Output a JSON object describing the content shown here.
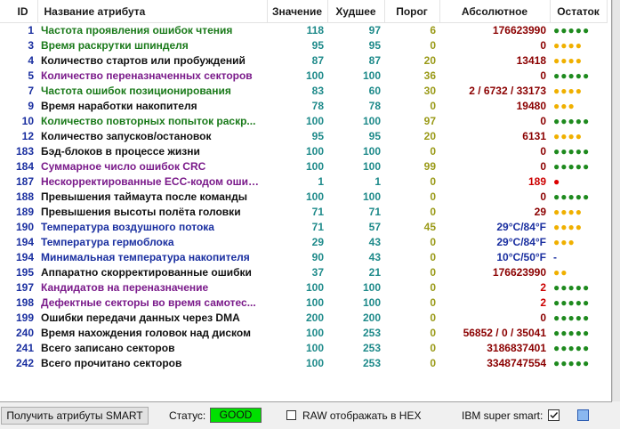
{
  "colors": {
    "blue": "#1a2fa0",
    "green": "#1a7a1a",
    "purple": "#7a1a8a",
    "black": "#111111",
    "red": "#cc0000",
    "current_value": "#1e8a8a",
    "threshold": "#9a9a18",
    "raw_value": "#8b0000",
    "dot_green": "#1e8a1e",
    "dot_yellow": "#f0b000",
    "dot_red": "#dd0000",
    "status_good": "#00e000"
  },
  "table": {
    "headers": {
      "id": "ID",
      "name": "Название атрибута",
      "current": "Значение",
      "worst": "Худшее",
      "threshold": "Порог",
      "raw": "Абсолютное",
      "remaining": "Остаток"
    },
    "rows": [
      {
        "id": "1",
        "name": "Частота проявления ошибок чтения",
        "name_color": "green",
        "current": "118",
        "worst": "97",
        "threshold": "6",
        "raw": "176623990",
        "raw_color": "raw_value",
        "remaining": "●●●●●",
        "remaining_color": "dot_green"
      },
      {
        "id": "3",
        "name": "Время раскрутки шпинделя",
        "name_color": "green",
        "current": "95",
        "worst": "95",
        "threshold": "0",
        "raw": "0",
        "raw_color": "raw_value",
        "remaining": "●●●●",
        "remaining_color": "dot_yellow"
      },
      {
        "id": "4",
        "name": "Количество стартов или пробуждений",
        "name_color": "black",
        "current": "87",
        "worst": "87",
        "threshold": "20",
        "raw": "13418",
        "raw_color": "raw_value",
        "remaining": "●●●●",
        "remaining_color": "dot_yellow"
      },
      {
        "id": "5",
        "name": "Количество переназначенных секторов",
        "name_color": "purple",
        "current": "100",
        "worst": "100",
        "threshold": "36",
        "raw": "0",
        "raw_color": "raw_value",
        "remaining": "●●●●●",
        "remaining_color": "dot_green"
      },
      {
        "id": "7",
        "name": "Частота ошибок позиционирования",
        "name_color": "green",
        "current": "83",
        "worst": "60",
        "threshold": "30",
        "raw": "2 / 6732 / 33173",
        "raw_color": "raw_value",
        "remaining": "●●●●",
        "remaining_color": "dot_yellow"
      },
      {
        "id": "9",
        "name": "Время наработки накопителя",
        "name_color": "black",
        "current": "78",
        "worst": "78",
        "threshold": "0",
        "raw": "19480",
        "raw_color": "raw_value",
        "remaining": "●●●",
        "remaining_color": "dot_yellow"
      },
      {
        "id": "10",
        "name": "Количество повторных попыток раскр...",
        "name_color": "green",
        "current": "100",
        "worst": "100",
        "threshold": "97",
        "raw": "0",
        "raw_color": "raw_value",
        "remaining": "●●●●●",
        "remaining_color": "dot_green"
      },
      {
        "id": "12",
        "name": "Количество запусков/остановок",
        "name_color": "black",
        "current": "95",
        "worst": "95",
        "threshold": "20",
        "raw": "6131",
        "raw_color": "raw_value",
        "remaining": "●●●●",
        "remaining_color": "dot_yellow"
      },
      {
        "id": "183",
        "name": "Бэд-блоков в процессе жизни",
        "name_color": "black",
        "current": "100",
        "worst": "100",
        "threshold": "0",
        "raw": "0",
        "raw_color": "raw_value",
        "remaining": "●●●●●",
        "remaining_color": "dot_green"
      },
      {
        "id": "184",
        "name": "Суммарное число ошибок CRC",
        "name_color": "purple",
        "current": "100",
        "worst": "100",
        "threshold": "99",
        "raw": "0",
        "raw_color": "raw_value",
        "remaining": "●●●●●",
        "remaining_color": "dot_green"
      },
      {
        "id": "187",
        "name": "Нескорректированные ECC-кодом ошиб...",
        "name_color": "purple",
        "current": "1",
        "worst": "1",
        "threshold": "0",
        "raw": "189",
        "raw_color": "red",
        "remaining": "●",
        "remaining_color": "dot_red"
      },
      {
        "id": "188",
        "name": "Превышения таймаута после команды",
        "name_color": "black",
        "current": "100",
        "worst": "100",
        "threshold": "0",
        "raw": "0",
        "raw_color": "raw_value",
        "remaining": "●●●●●",
        "remaining_color": "dot_green"
      },
      {
        "id": "189",
        "name": "Превышения высоты полёта головки",
        "name_color": "black",
        "current": "71",
        "worst": "71",
        "threshold": "0",
        "raw": "29",
        "raw_color": "raw_value",
        "remaining": "●●●●",
        "remaining_color": "dot_yellow"
      },
      {
        "id": "190",
        "name": "Температура воздушного потока",
        "name_color": "blue",
        "current": "71",
        "worst": "57",
        "threshold": "45",
        "raw": "29°C/84°F",
        "raw_color": "blue",
        "remaining": "●●●●",
        "remaining_color": "dot_yellow"
      },
      {
        "id": "194",
        "name": "Температура гермоблока",
        "name_color": "blue",
        "current": "29",
        "worst": "43",
        "threshold": "0",
        "raw": "29°C/84°F",
        "raw_color": "blue",
        "remaining": "●●●",
        "remaining_color": "dot_yellow"
      },
      {
        "id": "194",
        "name": "Минимальная температура накопителя",
        "name_color": "blue",
        "current": "90",
        "worst": "43",
        "threshold": "0",
        "raw": "10°C/50°F",
        "raw_color": "blue",
        "remaining": "-",
        "remaining_color": "blue"
      },
      {
        "id": "195",
        "name": "Аппаратно скорректированные ошибки",
        "name_color": "black",
        "current": "37",
        "worst": "21",
        "threshold": "0",
        "raw": "176623990",
        "raw_color": "raw_value",
        "remaining": "●●",
        "remaining_color": "dot_yellow"
      },
      {
        "id": "197",
        "name": "Кандидатов на переназначение",
        "name_color": "purple",
        "current": "100",
        "worst": "100",
        "threshold": "0",
        "raw": "2",
        "raw_color": "red",
        "remaining": "●●●●●",
        "remaining_color": "dot_green"
      },
      {
        "id": "198",
        "name": "Дефектные секторы во время самотес...",
        "name_color": "purple",
        "current": "100",
        "worst": "100",
        "threshold": "0",
        "raw": "2",
        "raw_color": "red",
        "remaining": "●●●●●",
        "remaining_color": "dot_green"
      },
      {
        "id": "199",
        "name": "Ошибки передачи данных через DMA",
        "name_color": "black",
        "current": "200",
        "worst": "200",
        "threshold": "0",
        "raw": "0",
        "raw_color": "raw_value",
        "remaining": "●●●●●",
        "remaining_color": "dot_green"
      },
      {
        "id": "240",
        "name": "Время нахождения головок над диском",
        "name_color": "black",
        "current": "100",
        "worst": "253",
        "threshold": "0",
        "raw": "56852 / 0 / 35041",
        "raw_color": "raw_value",
        "remaining": "●●●●●",
        "remaining_color": "dot_green"
      },
      {
        "id": "241",
        "name": "Всего записано секторов",
        "name_color": "black",
        "current": "100",
        "worst": "253",
        "threshold": "0",
        "raw": "3186837401",
        "raw_color": "raw_value",
        "remaining": "●●●●●",
        "remaining_color": "dot_green"
      },
      {
        "id": "242",
        "name": "Всего прочитано секторов",
        "name_color": "black",
        "current": "100",
        "worst": "253",
        "threshold": "0",
        "raw": "3348747554",
        "raw_color": "raw_value",
        "remaining": "●●●●●",
        "remaining_color": "dot_green"
      }
    ]
  },
  "statusbar": {
    "get_button_label": "Получить атрибуты SMART",
    "status_label": "Статус:",
    "status_value": "GOOD",
    "raw_hex_label": "RAW отображать в HEX",
    "raw_hex_checked": false,
    "ibm_label": "IBM super smart:",
    "ibm_checked": true
  }
}
